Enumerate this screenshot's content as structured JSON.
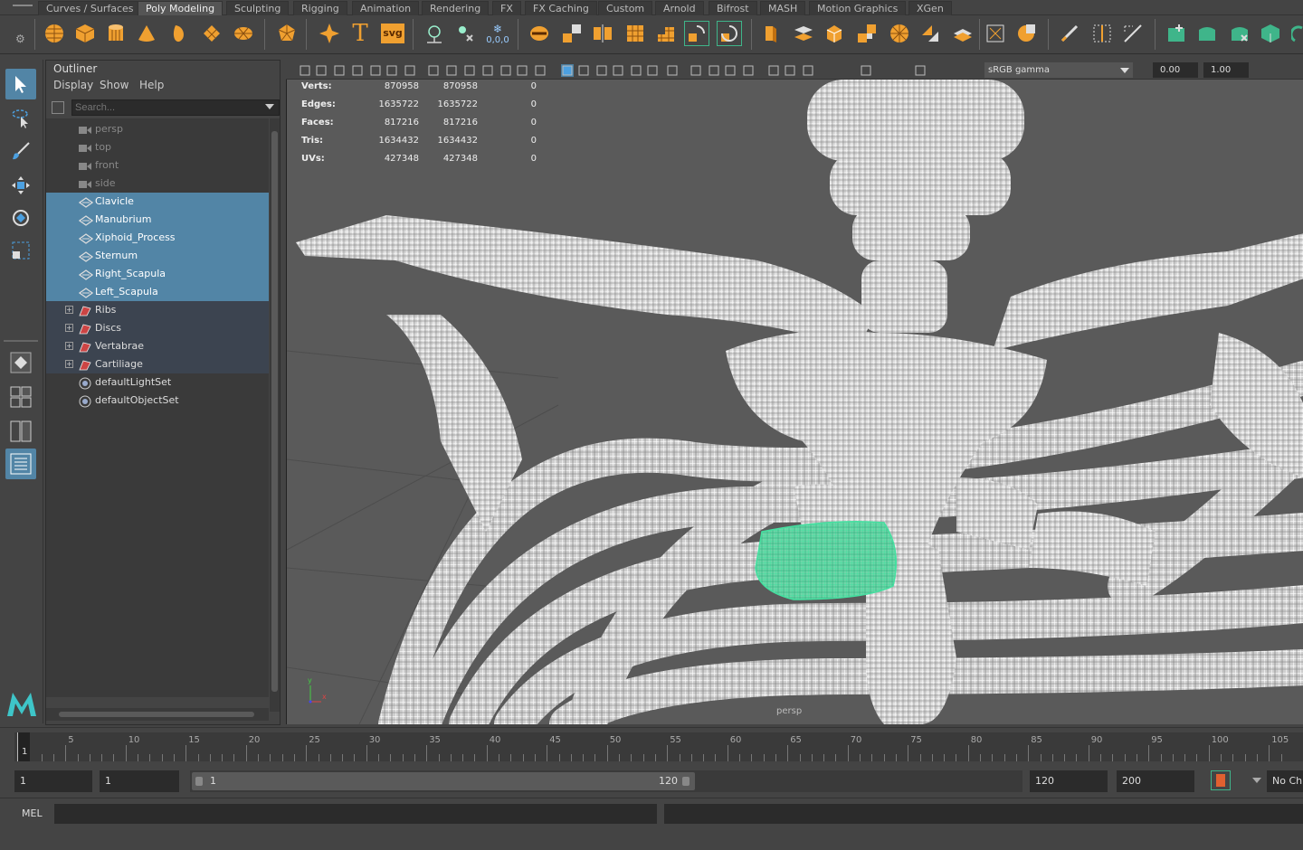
{
  "shelf_tabs": [
    {
      "label": "Curves / Surfaces",
      "active": false
    },
    {
      "label": "Poly Modeling",
      "active": true
    },
    {
      "label": "Sculpting",
      "active": false
    },
    {
      "label": "Rigging",
      "active": false
    },
    {
      "label": "Animation",
      "active": false
    },
    {
      "label": "Rendering",
      "active": false
    },
    {
      "label": "FX",
      "active": false
    },
    {
      "label": "FX Caching",
      "active": false
    },
    {
      "label": "Custom",
      "active": false
    },
    {
      "label": "Arnold",
      "active": false
    },
    {
      "label": "Bifrost",
      "active": false
    },
    {
      "label": "MASH",
      "active": false
    },
    {
      "label": "Motion Graphics",
      "active": false
    },
    {
      "label": "XGen",
      "active": false
    }
  ],
  "shelf_icons": {
    "poly_text": "T",
    "poly_svg": "svg",
    "pivot_label": "0,0,0"
  },
  "outliner": {
    "title": "Outliner",
    "menu": {
      "display": "Display",
      "show": "Show",
      "help": "Help"
    },
    "search_placeholder": "Search...",
    "items": [
      {
        "label": "persp",
        "type": "camera",
        "state": "dim"
      },
      {
        "label": "top",
        "type": "camera",
        "state": "dim"
      },
      {
        "label": "front",
        "type": "camera",
        "state": "dim"
      },
      {
        "label": "side",
        "type": "camera",
        "state": "dim"
      },
      {
        "label": "Clavicle",
        "type": "mesh",
        "state": "selected"
      },
      {
        "label": "Manubrium",
        "type": "mesh",
        "state": "selected"
      },
      {
        "label": "Xiphoid_Process",
        "type": "mesh",
        "state": "selected"
      },
      {
        "label": "Sternum",
        "type": "mesh",
        "state": "selected"
      },
      {
        "label": "Right_Scapula",
        "type": "mesh",
        "state": "selected"
      },
      {
        "label": "Left_Scapula",
        "type": "mesh",
        "state": "selected"
      },
      {
        "label": "Ribs",
        "type": "group",
        "state": "group"
      },
      {
        "label": "Discs",
        "type": "group",
        "state": "group"
      },
      {
        "label": "Vertabrae",
        "type": "group",
        "state": "group"
      },
      {
        "label": "Cartiliage",
        "type": "group",
        "state": "group"
      },
      {
        "label": "defaultLightSet",
        "type": "set",
        "state": "normal"
      },
      {
        "label": "defaultObjectSet",
        "type": "set",
        "state": "normal"
      }
    ]
  },
  "viewport": {
    "toolbar": {
      "exposure": "0.00",
      "gamma": "1.00",
      "color_space": "sRGB gamma"
    },
    "hud": [
      {
        "label": "Verts:",
        "v1": "870958",
        "v2": "870958",
        "v3": "0"
      },
      {
        "label": "Edges:",
        "v1": "1635722",
        "v2": "1635722",
        "v3": "0"
      },
      {
        "label": "Faces:",
        "v1": "817216",
        "v2": "817216",
        "v3": "0"
      },
      {
        "label": "Tris:",
        "v1": "1634432",
        "v2": "1634432",
        "v3": "0"
      },
      {
        "label": "UVs:",
        "v1": "427348",
        "v2": "427348",
        "v3": "0"
      }
    ],
    "camera": "persp",
    "axis_y": "y",
    "axis_x": "x",
    "colors": {
      "wire": "#ffffff",
      "selected_wire": "#44e0a0",
      "background": "#5a5a5a"
    }
  },
  "timeline": {
    "current_frame": "1",
    "ticks": [
      "5",
      "10",
      "15",
      "20",
      "25",
      "30",
      "35",
      "40",
      "45",
      "50",
      "55",
      "60",
      "65",
      "70",
      "75",
      "80",
      "85",
      "90",
      "95",
      "100",
      "105"
    ]
  },
  "range": {
    "start": "1",
    "playback_start": "1",
    "handle_start": "1",
    "handle_end": "120",
    "playback_end": "120",
    "end": "200",
    "char_set": "No Ch"
  },
  "command": {
    "label": "MEL"
  },
  "colors": {
    "accent": "#5285a6",
    "shelf_orange": "#f0a030",
    "shelf_green": "#3fb58a"
  }
}
